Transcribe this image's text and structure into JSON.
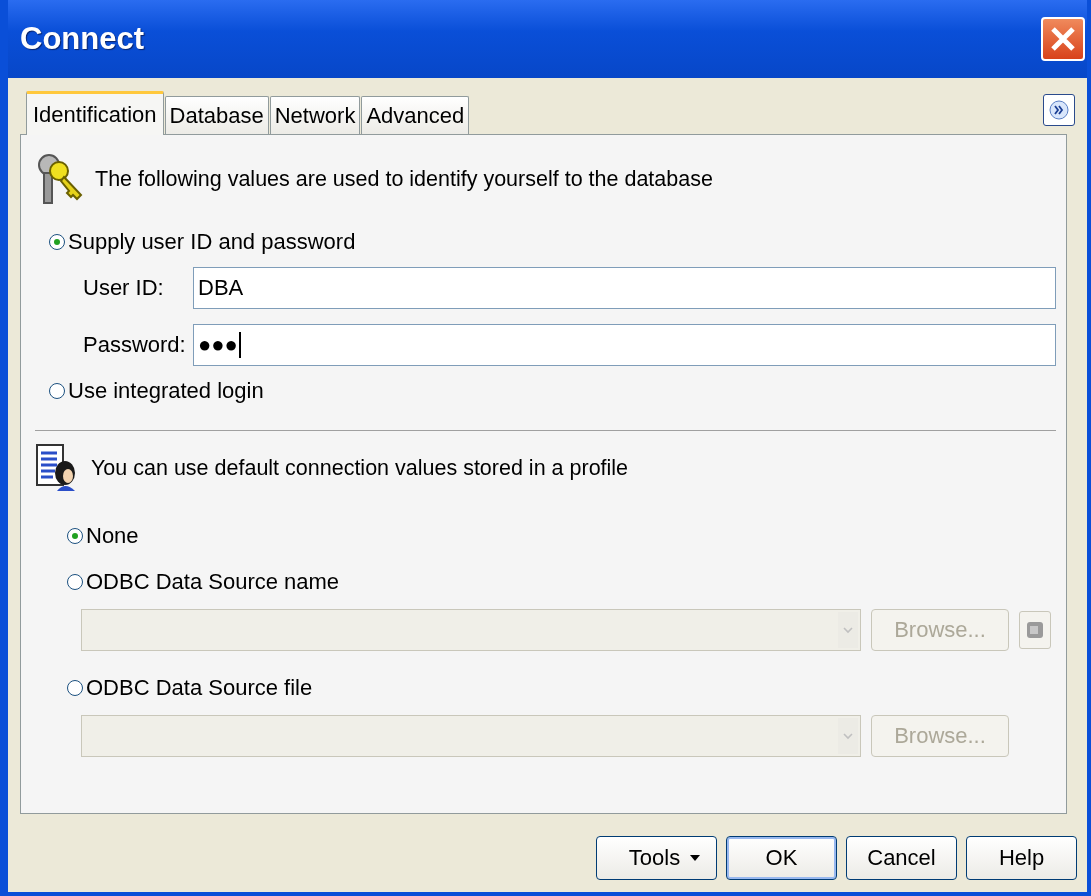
{
  "window": {
    "title": "Connect"
  },
  "tabs": [
    {
      "label": "Identification",
      "selected": true
    },
    {
      "label": "Database",
      "selected": false
    },
    {
      "label": "Network",
      "selected": false
    },
    {
      "label": "Advanced",
      "selected": false
    }
  ],
  "identification": {
    "heading": "The following values are used to identify yourself to the database",
    "supply_option": {
      "label": "Supply user ID and password",
      "selected": true
    },
    "fields": [
      {
        "label": "User ID:",
        "value": "DBA",
        "kind": "text"
      },
      {
        "label": "Password:",
        "value": "●●●",
        "kind": "password"
      }
    ],
    "integrated_option": {
      "label": "Use integrated login",
      "selected": false
    }
  },
  "profile": {
    "heading": "You can use default connection values stored in a profile",
    "options": [
      {
        "label": "None",
        "selected": true,
        "kind": "plain"
      },
      {
        "label": "ODBC Data Source name",
        "selected": false,
        "kind": "source",
        "combo_disabled": true,
        "browse": {
          "label": "Browse...",
          "disabled": true
        },
        "extra_button": true
      },
      {
        "label": "ODBC Data Source file",
        "selected": false,
        "kind": "source",
        "combo_disabled": true,
        "browse": {
          "label": "Browse...",
          "disabled": true
        },
        "extra_button": false
      }
    ]
  },
  "buttons": [
    {
      "label": "Tools",
      "kind": "menu"
    },
    {
      "label": "OK",
      "kind": "default"
    },
    {
      "label": "Cancel",
      "kind": "plain"
    },
    {
      "label": "Help",
      "kind": "plain"
    }
  ]
}
